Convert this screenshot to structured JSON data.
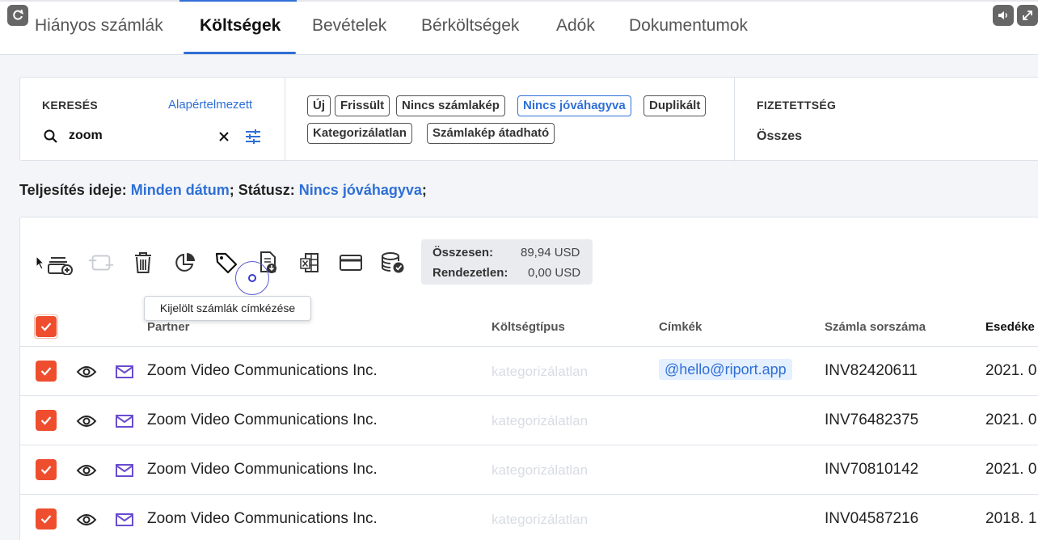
{
  "tabs": [
    {
      "label": "Hiányos számlák"
    },
    {
      "label": "Költségek"
    },
    {
      "label": "Bevételek"
    },
    {
      "label": "Bérköltségek"
    },
    {
      "label": "Adók"
    },
    {
      "label": "Dokumentumok"
    }
  ],
  "active_tab": "Költségek",
  "search": {
    "label": "KERESÉS",
    "default_link": "Alapértelmezett",
    "query": "zoom"
  },
  "status_chips": [
    {
      "label": "Új",
      "selected": false
    },
    {
      "label": "Frissült",
      "selected": false
    },
    {
      "label": "Nincs számlakép",
      "selected": false
    },
    {
      "label": "Nincs jóváhagyva",
      "selected": true
    },
    {
      "label": "Duplikált",
      "selected": false
    },
    {
      "label": "Kategorizálatlan",
      "selected": false
    },
    {
      "label": "Számlakép átadható",
      "selected": false
    }
  ],
  "payment": {
    "label": "FIZETETTSÉG",
    "value": "Összes"
  },
  "active_filters": {
    "date_label": "Teljesítés ideje:",
    "date_value": "Minden dátum",
    "status_label": "Státusz:",
    "status_value": "Nincs jóváhagyva",
    "sep": ";"
  },
  "totals": {
    "total_label": "Összesen:",
    "total_value": "89,94 USD",
    "unsettled_label": "Rendezetlen:",
    "unsettled_value": "0,00 USD"
  },
  "tooltip": "Kijelölt számlák címkézése",
  "columns": {
    "partner": "Partner",
    "cost_type": "Költségtípus",
    "tags": "Címkék",
    "invoice_number": "Számla sorszáma",
    "due": "Esedéke"
  },
  "rows": [
    {
      "partner": "Zoom Video Communications Inc.",
      "cost_type": "kategorizálatlan",
      "tag": "@hello@riport.app",
      "invoice": "INV82420611",
      "due": "2021. 0"
    },
    {
      "partner": "Zoom Video Communications Inc.",
      "cost_type": "kategorizálatlan",
      "tag": "",
      "invoice": "INV76482375",
      "due": "2021. 0"
    },
    {
      "partner": "Zoom Video Communications Inc.",
      "cost_type": "kategorizálatlan",
      "tag": "",
      "invoice": "INV70810142",
      "due": "2021. 0"
    },
    {
      "partner": "Zoom Video Communications Inc.",
      "cost_type": "kategorizálatlan",
      "tag": "",
      "invoice": "INV04587216",
      "due": "2018. 1"
    }
  ],
  "colors": {
    "accent": "#2f6fd6",
    "checkbox": "#ee4e2e",
    "mail_icon": "#6a4bd0"
  }
}
